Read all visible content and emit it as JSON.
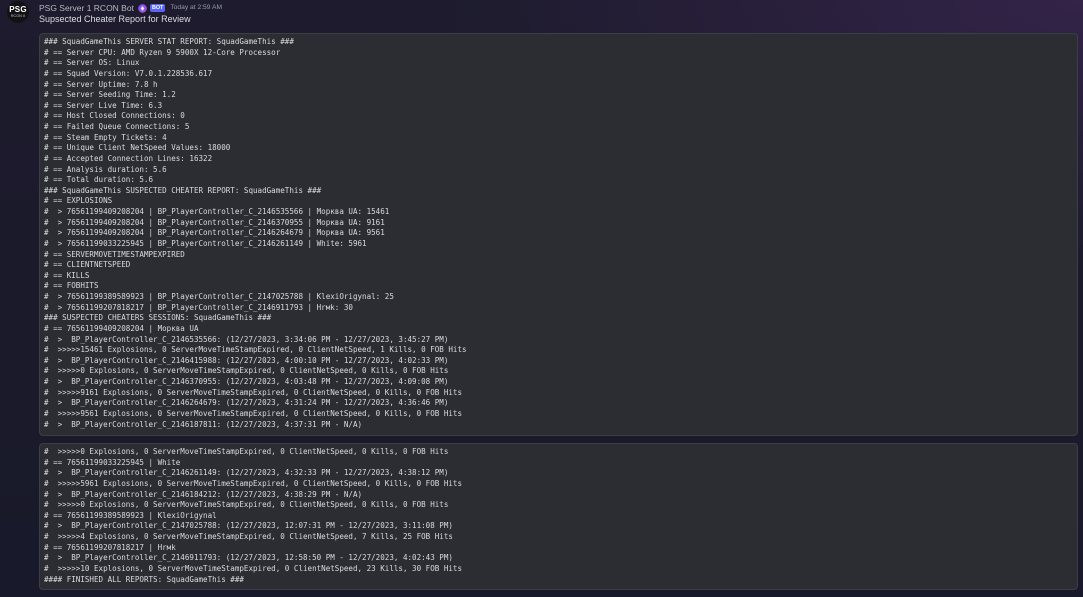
{
  "message": {
    "avatar": {
      "logo_text": "PSG",
      "logo_subtext": "RCON II"
    },
    "author": "PSG Server 1 RCON Bot",
    "bot_tag": "BOT",
    "timestamp": "Today at 2:59 AM",
    "content": "Supsected Cheater Report for Review",
    "code_blocks": [
      {
        "lines": [
          "### SquadGameThis SERVER STAT REPORT: SquadGameThis ###",
          "# == Server CPU: AMD Ryzen 9 5900X 12-Core Processor",
          "# == Server OS: Linux",
          "# == Squad Version: V7.0.1.228536.617",
          "# == Server Uptime: 7.8 h",
          "# == Server Seeding Time: 1.2",
          "# == Server Live Time: 6.3",
          "# == Host Closed Connections: 0",
          "# == Failed Queue Connections: 5",
          "# == Steam Empty Tickets: 4",
          "# == Unique Client NetSpeed Values: 18000",
          "# == Accepted Connection Lines: 16322",
          "# == Analysis duration: 5.6",
          "# == Total duration: 5.6",
          "### SquadGameThis SUSPECTED CHEATER REPORT: SquadGameThis ###",
          "# == EXPLOSIONS",
          "#  > 76561199409208204 | BP_PlayerController_C_2146535566 | Морква UA: 15461",
          "#  > 76561199409208204 | BP_PlayerController_C_2146370955 | Морква UA: 9161",
          "#  > 76561199409208204 | BP_PlayerController_C_2146264679 | Морква UA: 9561",
          "#  > 76561199033225945 | BP_PlayerController_C_2146261149 | White: 5961",
          "# == SERVERMOVETIMESTAMPEXPIRED",
          "# == CLIENTNETSPEED",
          "# == KILLS",
          "# == FOBHITS",
          "#  > 76561199389589923 | BP_PlayerController_C_2147025788 | KlexiOrigynal: 25",
          "#  > 76561199207818217 | BP_PlayerController_C_2146911793 | Hrмk: 30",
          "### SUSPECTED CHEATERS SESSIONS: SquadGameThis ###",
          "# == 76561199409208204 | Морква UA",
          "#  >  BP_PlayerController_C_2146535566: (12/27/2023, 3:34:06 PM - 12/27/2023, 3:45:27 PM)",
          "#  >>>>>15461 Explosions, 0 ServerMoveTimeStampExpired, 0 ClientNetSpeed, 1 Kills, 0 FOB Hits",
          "#  >  BP_PlayerController_C_2146415988: (12/27/2023, 4:00:10 PM - 12/27/2023, 4:02:33 PM)",
          "#  >>>>>0 Explosions, 0 ServerMoveTimeStampExpired, 0 ClientNetSpeed, 0 Kills, 0 FOB Hits",
          "#  >  BP_PlayerController_C_2146370955: (12/27/2023, 4:03:48 PM - 12/27/2023, 4:09:08 PM)",
          "#  >>>>>9161 Explosions, 0 ServerMoveTimeStampExpired, 0 ClientNetSpeed, 0 Kills, 0 FOB Hits",
          "#  >  BP_PlayerController_C_2146264679: (12/27/2023, 4:31:24 PM - 12/27/2023, 4:36:46 PM)",
          "#  >>>>>9561 Explosions, 0 ServerMoveTimeStampExpired, 0 ClientNetSpeed, 0 Kills, 0 FOB Hits",
          "#  >  BP_PlayerController_C_2146187811: (12/27/2023, 4:37:31 PM - N/A)"
        ]
      },
      {
        "lines": [
          "#  >>>>>0 Explosions, 0 ServerMoveTimeStampExpired, 0 ClientNetSpeed, 0 Kills, 0 FOB Hits",
          "# == 76561199033225945 | White",
          "#  >  BP_PlayerController_C_2146261149: (12/27/2023, 4:32:33 PM - 12/27/2023, 4:38:12 PM)",
          "#  >>>>>5961 Explosions, 0 ServerMoveTimeStampExpired, 0 ClientNetSpeed, 0 Kills, 0 FOB Hits",
          "#  >  BP_PlayerController_C_2146184212: (12/27/2023, 4:38:29 PM - N/A)",
          "#  >>>>>0 Explosions, 0 ServerMoveTimeStampExpired, 0 ClientNetSpeed, 0 Kills, 0 FOB Hits",
          "# == 76561199389589923 | KlexiOrigynal",
          "#  >  BP_PlayerController_C_2147025788: (12/27/2023, 12:07:31 PM - 12/27/2023, 3:11:08 PM)",
          "#  >>>>>4 Explosions, 0 ServerMoveTimeStampExpired, 0 ClientNetSpeed, 7 Kills, 25 FOB Hits",
          "# == 76561199207818217 | Hrмk",
          "#  >  BP_PlayerController_C_2146911793: (12/27/2023, 12:58:50 PM - 12/27/2023, 4:02:43 PM)",
          "#  >>>>>10 Explosions, 0 ServerMoveTimeStampExpired, 0 ClientNetSpeed, 23 Kills, 30 FOB Hits",
          "#### FINISHED ALL REPORTS: SquadGameThis ###"
        ]
      }
    ]
  },
  "icons": {
    "role": "role-badge-icon"
  },
  "colors": {
    "background": "#1c1b2c",
    "code_block_background": "#2c2d33",
    "code_block_border": "#3c3e45",
    "author": "#b5bac1",
    "timestamp": "#949ba4",
    "message_text": "#dbdee1",
    "bot_tag": "#5865f2",
    "role_badge": "#8b5cf6"
  }
}
